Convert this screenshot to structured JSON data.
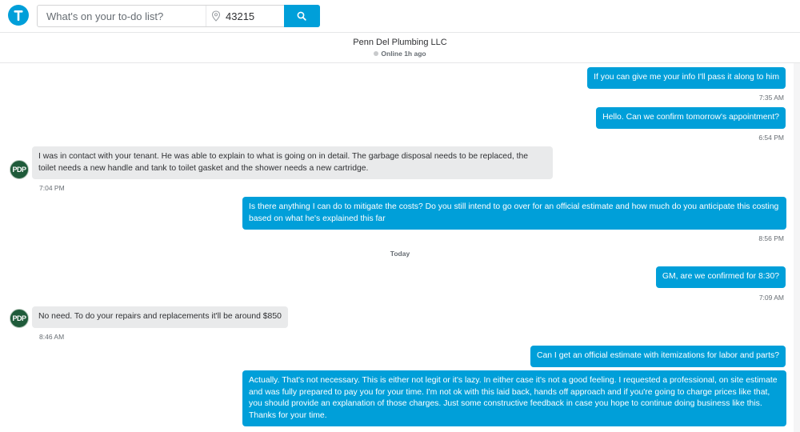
{
  "search": {
    "placeholder": "What's on your to-do list?",
    "zip_value": "43215"
  },
  "conversation": {
    "business_name": "Penn Del Plumbing LLC",
    "status": "Online 1h ago",
    "avatar_initials": "PDP"
  },
  "messages": [
    {
      "from": "me",
      "text": "If you can give me your info I'll pass it along to him",
      "time": "7:35 AM"
    },
    {
      "from": "me",
      "text": "Hello. Can we confirm tomorrow's appointment?",
      "time": "6:54 PM"
    },
    {
      "from": "pro",
      "text": "I was in contact with your tenant. He was able to explain to what is going on in detail. The garbage disposal needs to be replaced, the toilet needs a new handle and tank to toilet gasket and the shower needs a new cartridge.",
      "time": "7:04 PM"
    },
    {
      "from": "me",
      "text": "Is there anything I can do to mitigate the costs? Do you still intend to go over for an official estimate and how much do you anticipate this costing based on what he's explained this far",
      "time": "8:56 PM"
    },
    {
      "from": "me",
      "text": "GM, are we confirmed for 8:30?",
      "time": "7:09 AM"
    },
    {
      "from": "pro",
      "text": "No need. To do your repairs and replacements it'll be around $850",
      "time": "8:46 AM"
    },
    {
      "from": "me",
      "text": "Can I get an official estimate with itemizations for labor and parts?",
      "time": ""
    },
    {
      "from": "me",
      "text": "Actually. That's not necessary. This is either not legit or it's lazy. In either case it's not a good feeling. I requested a professional, on site estimate and was fully prepared to pay you for your time. I'm not ok with this laid back, hands off approach and if you're going to charge prices like that, you should provide an explanation of those charges. Just some constructive feedback in case you hope to continue doing business like this. Thanks for your time.",
      "time": ""
    }
  ],
  "day_separator": "Today",
  "colors": {
    "accent": "#009fd9",
    "incoming_bubble": "#e9eaeb",
    "text": "#2f3033",
    "muted": "#676d73"
  },
  "icons": {
    "logo": "thumbtack-logo-icon",
    "location": "map-pin-icon",
    "search": "search-icon"
  }
}
